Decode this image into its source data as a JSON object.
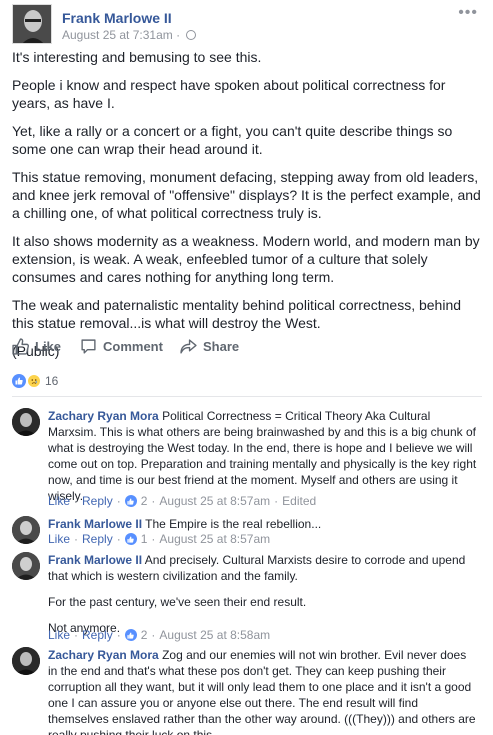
{
  "post": {
    "author": "Frank Marlowe II",
    "timestamp": "August 25 at 7:31am",
    "separator": "·",
    "more_label": "•••",
    "paragraphs": [
      "It's interesting and bemusing to see this.",
      "People i know and respect have spoken about political correctness for years, as have I.",
      "Yet, like a rally or a concert or a fight, you can't quite describe things so some one can wrap their head around it.",
      "This statue removing, monument defacing, stepping away from old leaders, and knee jerk removal of \"offensive\" displays? It is the perfect example, and a chilling one, of what political correctness truly is.",
      "It also shows modernity as a weakness. Modern world, and modern man by extension, is weak. A weak, enfeebled tumor of a culture that solely consumes and cares nothing for anything long term.",
      "The weak and paternalistic mentality behind political correctness, behind this statue removal...is what will destroy the West.",
      "(Public)"
    ]
  },
  "actions": {
    "like": "Like",
    "comment": "Comment",
    "share": "Share"
  },
  "reactions": {
    "count": "16"
  },
  "comments": [
    {
      "author": "Zachary Ryan Mora",
      "text": "Political Correctness = Critical Theory Aka Cultural Marxsim. This is what others are being brainwashed by and this is a big chunk of what is destroying the West today. In the end, there is hope and I believe we will come out on top. Preparation and training mentally and physically is the key right now, and time is our best friend at the moment. Myself and others are using it wisely.",
      "like": "Like",
      "reply": "Reply",
      "likes": "2",
      "time": "August 25 at 8:57am",
      "edited": "Edited"
    },
    {
      "author": "Frank Marlowe II",
      "text": "The Empire is the real rebellion...",
      "like": "Like",
      "reply": "Reply",
      "likes": "1",
      "time": "August 25 at 8:57am"
    },
    {
      "author": "Frank Marlowe II",
      "text": "And precisely. Cultural Marxists desire to corrode and upend that which is western civilization and the family.",
      "extra1": "For the past century, we've seen their end result.",
      "extra2": "Not anymore.",
      "like": "Like",
      "reply": "Reply",
      "likes": "2",
      "time": "August 25 at 8:58am"
    },
    {
      "author": "Zachary Ryan Mora",
      "text": "Zog and our enemies will not win brother. Evil never does in the end and that's what these pos don't get. They can keep pushing their corruption all they want, but it will only lead them to one place and it isn't a good one I can assure you or anyone else out there. The end result will find themselves enslaved rather than the other way around. (((They))) and others are really pushing their luck on this."
    }
  ]
}
